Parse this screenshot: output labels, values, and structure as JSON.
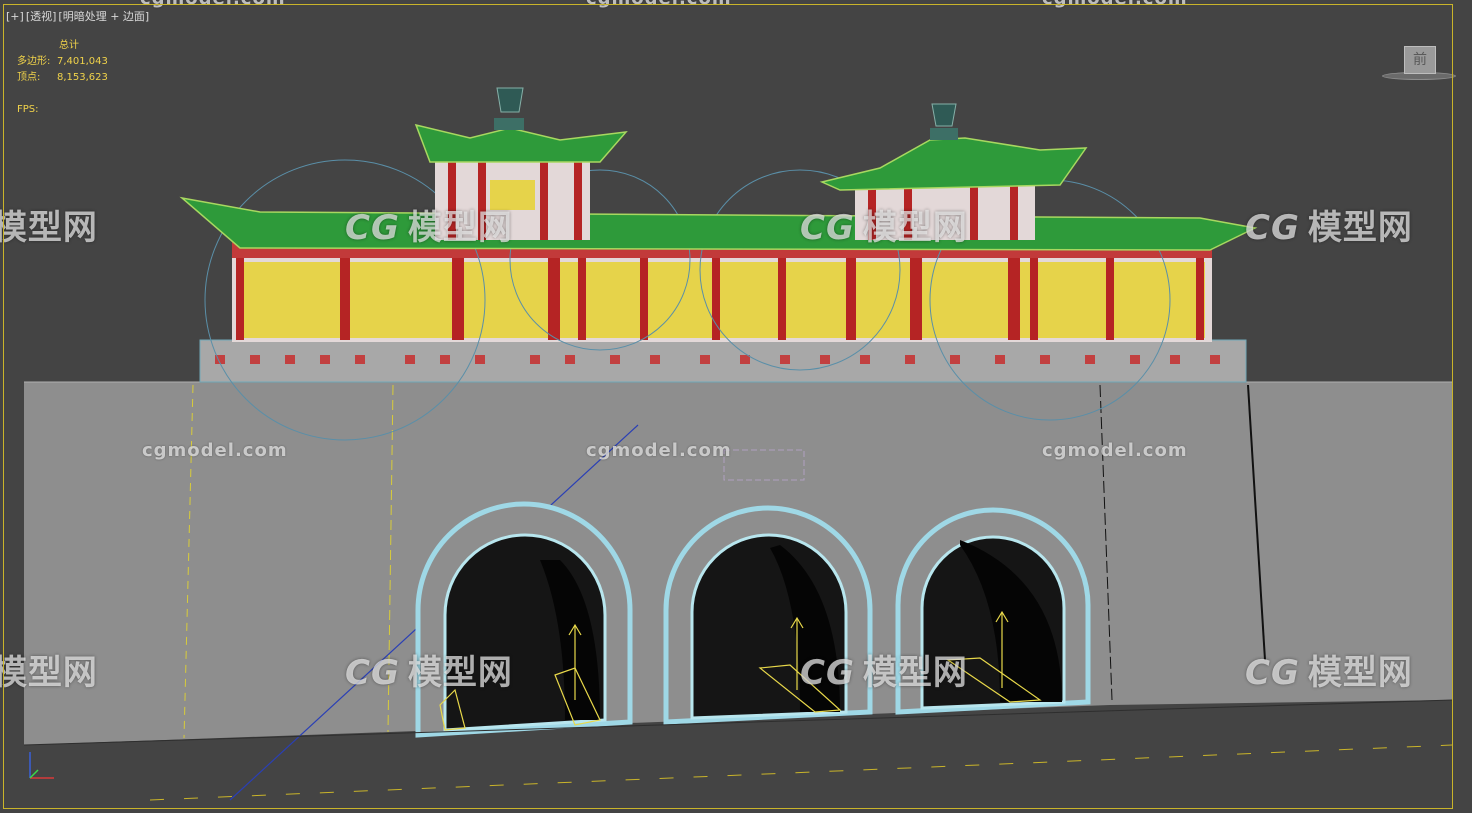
{
  "viewport": {
    "label_parts": [
      "[+]",
      "[透视]",
      "[明暗处理 + 边面]"
    ]
  },
  "stats": {
    "total_label": "总计",
    "polys_label": "多边形:",
    "polys_value": "7,401,043",
    "verts_label": "顶点:",
    "verts_value": "8,153,623",
    "fps_label": "FPS:"
  },
  "viewcube": {
    "face_label": "前"
  },
  "watermarks": {
    "site": "cgmodel.com",
    "logo_cg": "CG",
    "logo_text": "模型网"
  },
  "colors": {
    "background": "#444444",
    "ground": "#8e8e8e",
    "frame_highlight": "#c9b42a",
    "roof_green": "#2e9a3a",
    "column_red": "#b52424",
    "lattice_yellow": "#e6d34a",
    "arch_trim": "#9fd8e6",
    "stats_text": "#f0d24a"
  }
}
